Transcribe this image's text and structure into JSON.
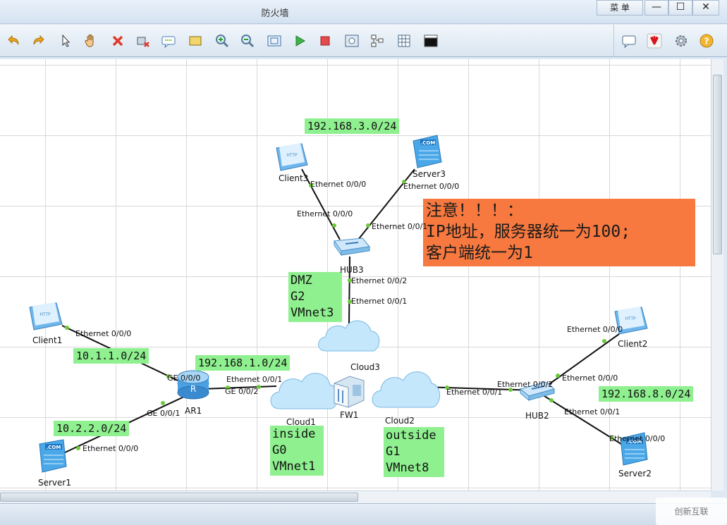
{
  "window": {
    "title": "防火墙",
    "menu_label": "菜 单",
    "minimize": "—",
    "maximize": "☐",
    "close": "✕"
  },
  "toolbar": {
    "left_tools": [
      "undo-icon",
      "redo-icon",
      "pointer-icon",
      "hand-icon",
      "delete-icon",
      "delete-link-icon",
      "text-icon",
      "rectangle-icon",
      "zoom-in-icon",
      "zoom-out-icon",
      "fit-icon",
      "start-icon",
      "stop-icon",
      "capture-icon",
      "topology-icon",
      "grid-icon",
      "terminal-icon"
    ],
    "right_tools": [
      "chat-icon",
      "huawei-icon",
      "settings-icon",
      "help-icon"
    ]
  },
  "devices": {
    "client3": "Client3",
    "server3": "Server3",
    "hub3": "HUB3",
    "cloud3": "Cloud3",
    "client1": "Client1",
    "ar1": "AR1",
    "server1": "Server1",
    "cloud1": "Cloud1",
    "fw1": "FW1",
    "cloud2": "Cloud2",
    "hub2": "HUB2",
    "client2": "Client2",
    "server2": "Server2"
  },
  "ports": {
    "client3_e000": "Ethernet 0/0/0",
    "server3_e000": "Ethernet 0/0/0",
    "hub3_e000": "Ethernet 0/0/0",
    "hub3_e001": "Ethernet 0/0/1",
    "hub3_e002": "Ethernet 0/0/2",
    "cloud3_e001": "Ethernet 0/0/1",
    "client1_e000": "Ethernet 0/0/0",
    "ar1_ge000": "GE 0/0/0",
    "ar1_ge002": "GE 0/0/2",
    "ar1_ge001": "GE 0/0/1",
    "cloud1_e001": "Ethernet 0/0/1",
    "server1_e000": "Ethernet 0/0/0",
    "cloud2_e001": "Ethernet 0/0/1",
    "hub2_e002": "Ethernet 0/0/2",
    "hub2_e000": "Ethernet 0/0/0",
    "hub2_e001": "Ethernet 0/0/1",
    "client2_e000": "Ethernet 0/0/0",
    "server2_e000": "Ethernet 0/0/0"
  },
  "subnets": {
    "dmz_net": "192.168.3.0/24",
    "client1_net": "10.1.1.0/24",
    "inside_net": "192.168.1.0/24",
    "server1_net": "10.2.2.0/24",
    "outside_net": "192.168.8.0/24"
  },
  "zones": {
    "dmz": [
      "DMZ",
      "G2",
      "VMnet3"
    ],
    "inside": [
      "inside",
      "G0",
      "VMnet1"
    ],
    "outside": [
      "outside",
      "G1",
      "VMnet8"
    ]
  },
  "note": [
    "注意！！！：",
    "IP地址，服务器统一为100;",
    "客户端统一为1"
  ],
  "watermark": "创新互联",
  "colors": {
    "note_bg": "#f7793f",
    "label_bg": "#8ff08f",
    "port_dot": "#6cc93a"
  }
}
